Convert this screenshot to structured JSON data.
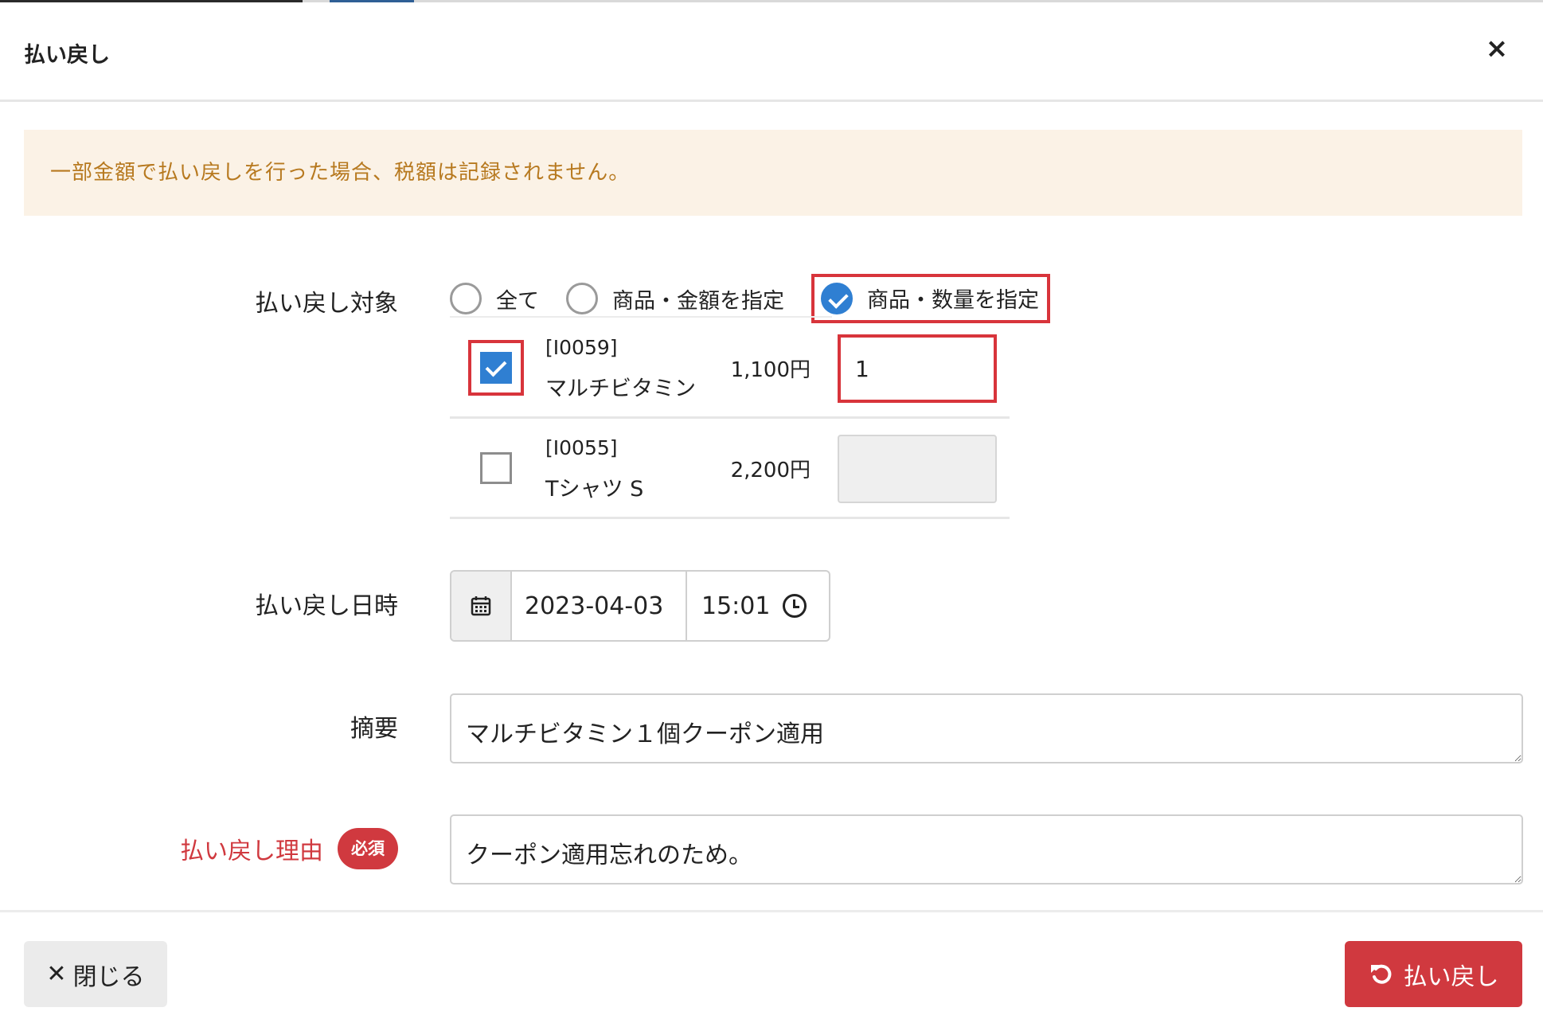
{
  "modal": {
    "title": "払い戻し",
    "close_icon": "×"
  },
  "alert": {
    "text": "一部金額で払い戻しを行った場合、税額は記録されません。"
  },
  "refund_target": {
    "label": "払い戻し対象",
    "options": [
      {
        "label": "全て",
        "checked": false
      },
      {
        "label": "商品・金額を指定",
        "checked": false
      },
      {
        "label": "商品・数量を指定",
        "checked": true
      }
    ]
  },
  "items": [
    {
      "code": "[I0059]",
      "name": "マルチビタミン",
      "price": "1,100円",
      "checked": true,
      "quantity": "1"
    },
    {
      "code": "[I0055]",
      "name": "Tシャツ S",
      "price": "2,200円",
      "checked": false,
      "quantity": ""
    }
  ],
  "datetime": {
    "label": "払い戻し日時",
    "date": "2023-04-03",
    "time": "15:01"
  },
  "summary": {
    "label": "摘要",
    "value": "マルチビタミン１個クーポン適用"
  },
  "reason": {
    "label": "払い戻し理由",
    "required_badge": "必須",
    "value": "クーポン適用忘れのため。"
  },
  "footer": {
    "close_label": "閉じる",
    "refund_label": "払い戻し"
  },
  "colors": {
    "primary": "#2f7fd2",
    "danger": "#d0393f",
    "alert_bg": "#fbf2e6",
    "alert_text": "#b7791f",
    "highlight_border": "#d8343b"
  }
}
